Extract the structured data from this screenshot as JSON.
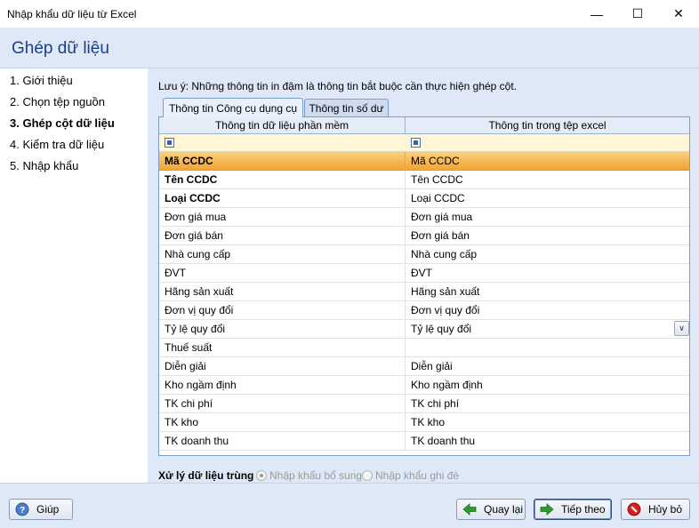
{
  "window": {
    "title": "Nhập khẩu dữ liệu từ Excel",
    "minimize_label": "—",
    "maximize_label": "☐",
    "close_label": "✕"
  },
  "header": {
    "title": "Ghép dữ liệu"
  },
  "steps": [
    {
      "label": "1. Giới thiệu",
      "active": false
    },
    {
      "label": "2. Chọn tệp nguồn",
      "active": false
    },
    {
      "label": "3. Ghép cột dữ liệu",
      "active": true
    },
    {
      "label": "4. Kiểm tra dữ liệu",
      "active": false
    },
    {
      "label": "5. Nhập khẩu",
      "active": false
    }
  ],
  "main": {
    "note": "Lưu ý: Những thông tin in đậm là thông tin bắt buộc cần thực hiện ghép cột.",
    "tabs": [
      {
        "label": "Thông tin Công cụ dụng cụ",
        "active": true
      },
      {
        "label": "Thông tin số dư",
        "active": false
      }
    ],
    "grid": {
      "columns": [
        "Thông tin dữ liệu phần mềm",
        "Thông tin trong tệp excel"
      ],
      "rows": [
        {
          "field": "Mã CCDC",
          "excel": "Mã CCDC",
          "required": true,
          "selected": true
        },
        {
          "field": "Tên CCDC",
          "excel": "Tên CCDC",
          "required": true
        },
        {
          "field": "Loại CCDC",
          "excel": "Loại CCDC",
          "required": true
        },
        {
          "field": "Đơn giá mua",
          "excel": "Đơn giá mua"
        },
        {
          "field": "Đơn giá bán",
          "excel": "Đơn giá bán"
        },
        {
          "field": "Nhà cung cấp",
          "excel": "Nhà cung cấp"
        },
        {
          "field": "ĐVT",
          "excel": "ĐVT"
        },
        {
          "field": "Hãng sản xuất",
          "excel": "Hãng sản xuất"
        },
        {
          "field": "Đơn vị quy đổi",
          "excel": "Đơn vị quy đổi"
        },
        {
          "field": "Tỷ lệ quy đổi",
          "excel": "Tỷ lệ quy đổi",
          "dropdown": true
        },
        {
          "field": "Thuế suất",
          "excel": ""
        },
        {
          "field": "Diễn giải",
          "excel": "Diễn giải"
        },
        {
          "field": "Kho ngầm định",
          "excel": "Kho ngầm định"
        },
        {
          "field": "TK chi phí",
          "excel": "TK chi phí"
        },
        {
          "field": "TK kho",
          "excel": "TK kho"
        },
        {
          "field": "TK doanh thu",
          "excel": "TK doanh thu"
        }
      ]
    },
    "duplicate": {
      "label": "Xử lý dữ liệu trùng",
      "options": [
        {
          "label": "Nhập khẩu bổ sung",
          "checked": true
        },
        {
          "label": "Nhập khẩu ghi đè",
          "checked": false
        }
      ]
    }
  },
  "footer": {
    "help_label": "Giúp",
    "back_label": "Quay lại",
    "next_label": "Tiếp theo",
    "cancel_label": "Hủy bỏ"
  },
  "colors": {
    "header_bg": "#dfe8f6",
    "title_blue": "#1b3f8b",
    "selected_row": "#f1a431",
    "filter_row": "#fff6d8",
    "back_arrow": "#2e9a2e",
    "cancel_icon": "#d42020"
  }
}
